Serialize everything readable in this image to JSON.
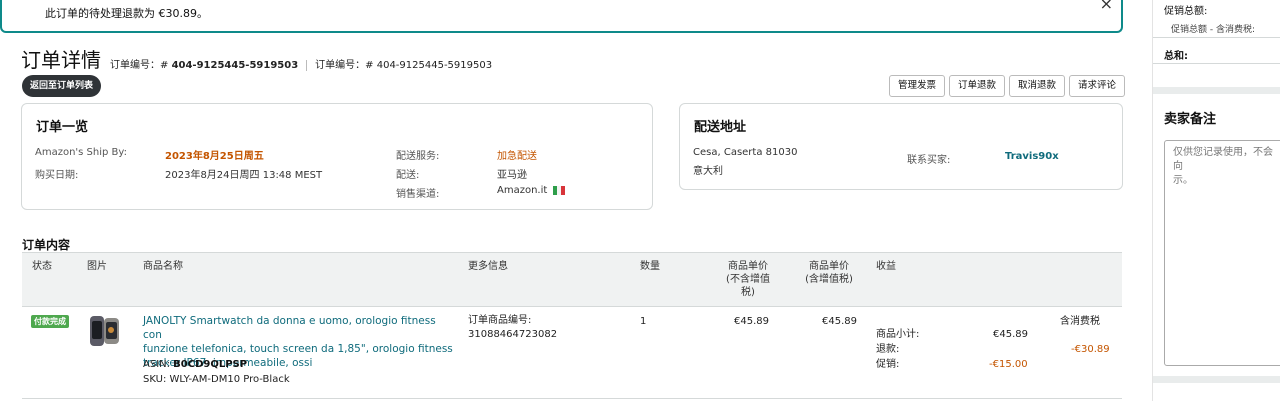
{
  "alert": {
    "message": "此订单的待处理退款为 €30.89。",
    "close": "×"
  },
  "header": {
    "title": "订单详情",
    "order_label_1": "订单编号：# ",
    "order_id_1": "404-9125445-5919503",
    "order_label_2": "订单编号：# ",
    "order_id_2": "404-9125445-5919503",
    "back": "返回至订单列表"
  },
  "actions": [
    "管理发票",
    "订单退款",
    "取消退款",
    "请求评论"
  ],
  "summary": {
    "title": "订单一览",
    "ship_by_label": "Amazon's Ship By:",
    "ship_by_value": "2023年8月25日周五",
    "purchase_label": "购买日期:",
    "purchase_value": "2023年8月24日周四 13:48 MEST",
    "service_label": "配送服务:",
    "service_value": "加急配送",
    "fulfill_label": "配送:",
    "fulfill_value": "亚马逊",
    "channel_label": "销售渠道:",
    "channel_value": "Amazon.it"
  },
  "shipping": {
    "title": "配送地址",
    "line1": "Cesa, Caserta 81030",
    "line2": "意大利",
    "contact_label": "联系买家:",
    "buyer": "Travis90x"
  },
  "right_panel": {
    "promo_total": "促销总额:",
    "promo_sub": "促销总额 - 含消费税:",
    "total": "总和:",
    "notes_title": "卖家备注",
    "notes_placeholder_1": "仅供您记录使用，不会向",
    "notes_placeholder_2": "示。"
  },
  "contents": {
    "title": "订单内容",
    "headers": {
      "status": "状态",
      "image": "图片",
      "name": "商品名称",
      "more": "更多信息",
      "qty": "数量",
      "price_ex_1": "商品单价",
      "price_ex_2": "(不含增值",
      "price_ex_3": "税)",
      "price_in_1": "商品单价",
      "price_in_2": "(含增值税)",
      "income": "收益"
    },
    "row": {
      "status": "付款完成",
      "name_1": "JANOLTY Smartwatch da donna e uomo, orologio fitness con",
      "name_2": "funzione telefonica, touch screen da 1,85\", orologio fitness",
      "name_3": "tracker IP67, impermeabile, ossi",
      "asin_label": "ASIN: ",
      "asin": "B0CD9QLPSP",
      "sku": "SKU: WLY-AM-DM10 Pro-Black",
      "item_id_label": "订单商品编号:",
      "item_id": "31088464723082",
      "qty": "1",
      "price_ex": "€45.89",
      "price_in": "€45.89",
      "tax_note": "含消费税",
      "subtotal_label": "商品小计:",
      "subtotal": "€45.89",
      "refund_label": "退款:",
      "refund": "-€30.89",
      "promo_label": "促销:",
      "promo": "-€15.00"
    }
  }
}
